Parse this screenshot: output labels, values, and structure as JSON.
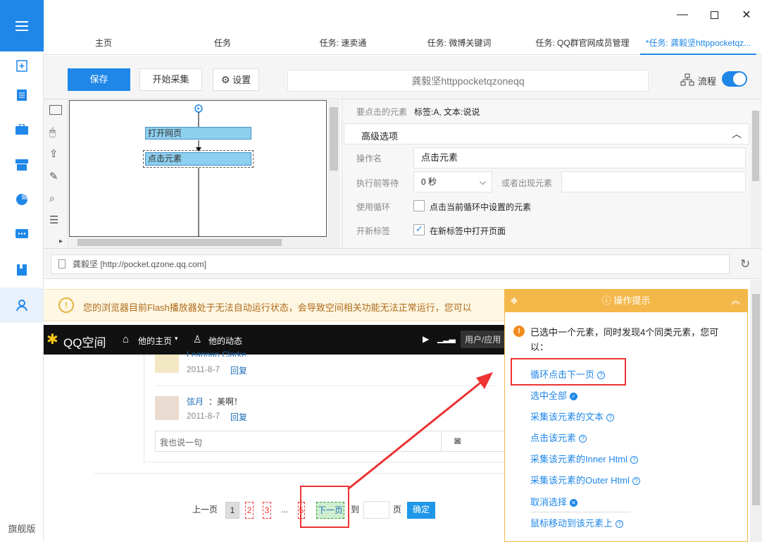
{
  "sidebar": {
    "edition_label": "旗舰版"
  },
  "tabs": [
    {
      "label": "主页"
    },
    {
      "label": "任务"
    },
    {
      "label": "任务: 速卖通"
    },
    {
      "label": "任务: 微博关键词"
    },
    {
      "label": "任务: QQ群官网成员管理"
    },
    {
      "label": "*任务: 龚毅坚httppocketqz..."
    }
  ],
  "toolbar": {
    "save_label": "保存",
    "start_label": "开始采集",
    "settings_label": "设置",
    "task_name": "龚毅坚httppocketqzoneqq",
    "flow_label": "流程",
    "flow_toggle": "on"
  },
  "flow": {
    "nodes": [
      {
        "label": "打开网页"
      },
      {
        "label": "点击元素"
      }
    ]
  },
  "props": {
    "target_label": "要点击的元素",
    "target_value": "标签:A, 文本:说说",
    "advanced_label": "高级选项",
    "op_name_label": "操作名",
    "op_name_value": "点击元素",
    "wait_label": "执行前等待",
    "wait_value": "0 秒",
    "or_appear_label": "或者出现元素",
    "or_appear_value": "",
    "loop_label": "使用循环",
    "loop_text": "点击当前循环中设置的元素",
    "newtab_label": "开新标签",
    "newtab_text": "在新标签中打开页面"
  },
  "url": {
    "text": "龚毅坚 [http://pocket.qzone.qq.com]"
  },
  "page": {
    "flash_warning": "您的浏览器目前Flash播放器处于无法自动运行状态，会导致空间相关功能无法正常运行，您可以",
    "qq_logo": "QQ空间",
    "nav_home": "他的主页",
    "nav_feed": "他的动态",
    "nav_user": "用户/应用",
    "comments": [
      {
        "author": "Leannan Clarke",
        "text": "：我爱予也素说说",
        "date": "2011-8-7",
        "reply": "回复"
      },
      {
        "author": "弦月",
        "text": "：美啊！",
        "date": "2011-8-7",
        "reply": "回复"
      }
    ],
    "comment_placeholder": "我也说一句",
    "pager": {
      "prev": "上一页",
      "p1": "1",
      "p2": "2",
      "p3": "3",
      "dots": "...",
      "p5": "5",
      "next": "下一页",
      "to": "到",
      "page": "页",
      "ok": "确定"
    }
  },
  "tip": {
    "title": "操作提示",
    "message": "已选中一个元素，同时发现4个同类元素，您可以：",
    "options": [
      {
        "label": "循环点击下一页"
      },
      {
        "label": "选中全部"
      },
      {
        "label": "采集该元素的文本"
      },
      {
        "label": "点击该元素"
      },
      {
        "label": "采集该元素的Inner Html"
      },
      {
        "label": "采集该元素的Outer Html"
      },
      {
        "label": "取消选择"
      },
      {
        "label": "鼠标移动到该元素上"
      }
    ]
  },
  "colors": {
    "accent": "#1f87e8",
    "warning": "#f4b84a",
    "highlight": "#e33333"
  }
}
